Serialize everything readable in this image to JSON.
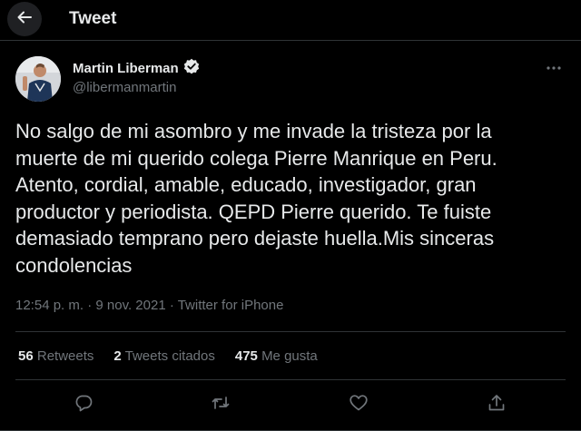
{
  "header": {
    "title": "Tweet",
    "back_icon": "arrow-left-icon"
  },
  "author": {
    "name": "Martin Liberman",
    "handle": "@libermanmartin",
    "verified": true,
    "verified_color": "#e7e9ea"
  },
  "tweet": {
    "text": "No salgo de mi asombro y me invade la tristeza por la\nmuerte de mi querido colega Pierre Manrique en Peru.\nAtento, cordial, amable, educado, investigador, gran\nproductor y periodista. QEPD Pierre querido. Te fuiste\ndemasiado temprano pero dejaste huella.Mis sinceras\ncondolencias",
    "timestamp": "12:54 p. m. · 9 nov. 2021 · ",
    "source": "Twitter for iPhone"
  },
  "stats": {
    "retweets_count": "56",
    "retweets_label": "Retweets",
    "quotes_count": "2",
    "quotes_label": "Tweets citados",
    "likes_count": "475",
    "likes_label": "Me gusta"
  },
  "actions": [
    "reply-icon",
    "retweet-icon",
    "like-icon",
    "share-icon"
  ],
  "colors": {
    "background": "#000000",
    "text_primary": "#e7e9ea",
    "text_secondary": "#71767b",
    "divider": "#2f3336"
  }
}
